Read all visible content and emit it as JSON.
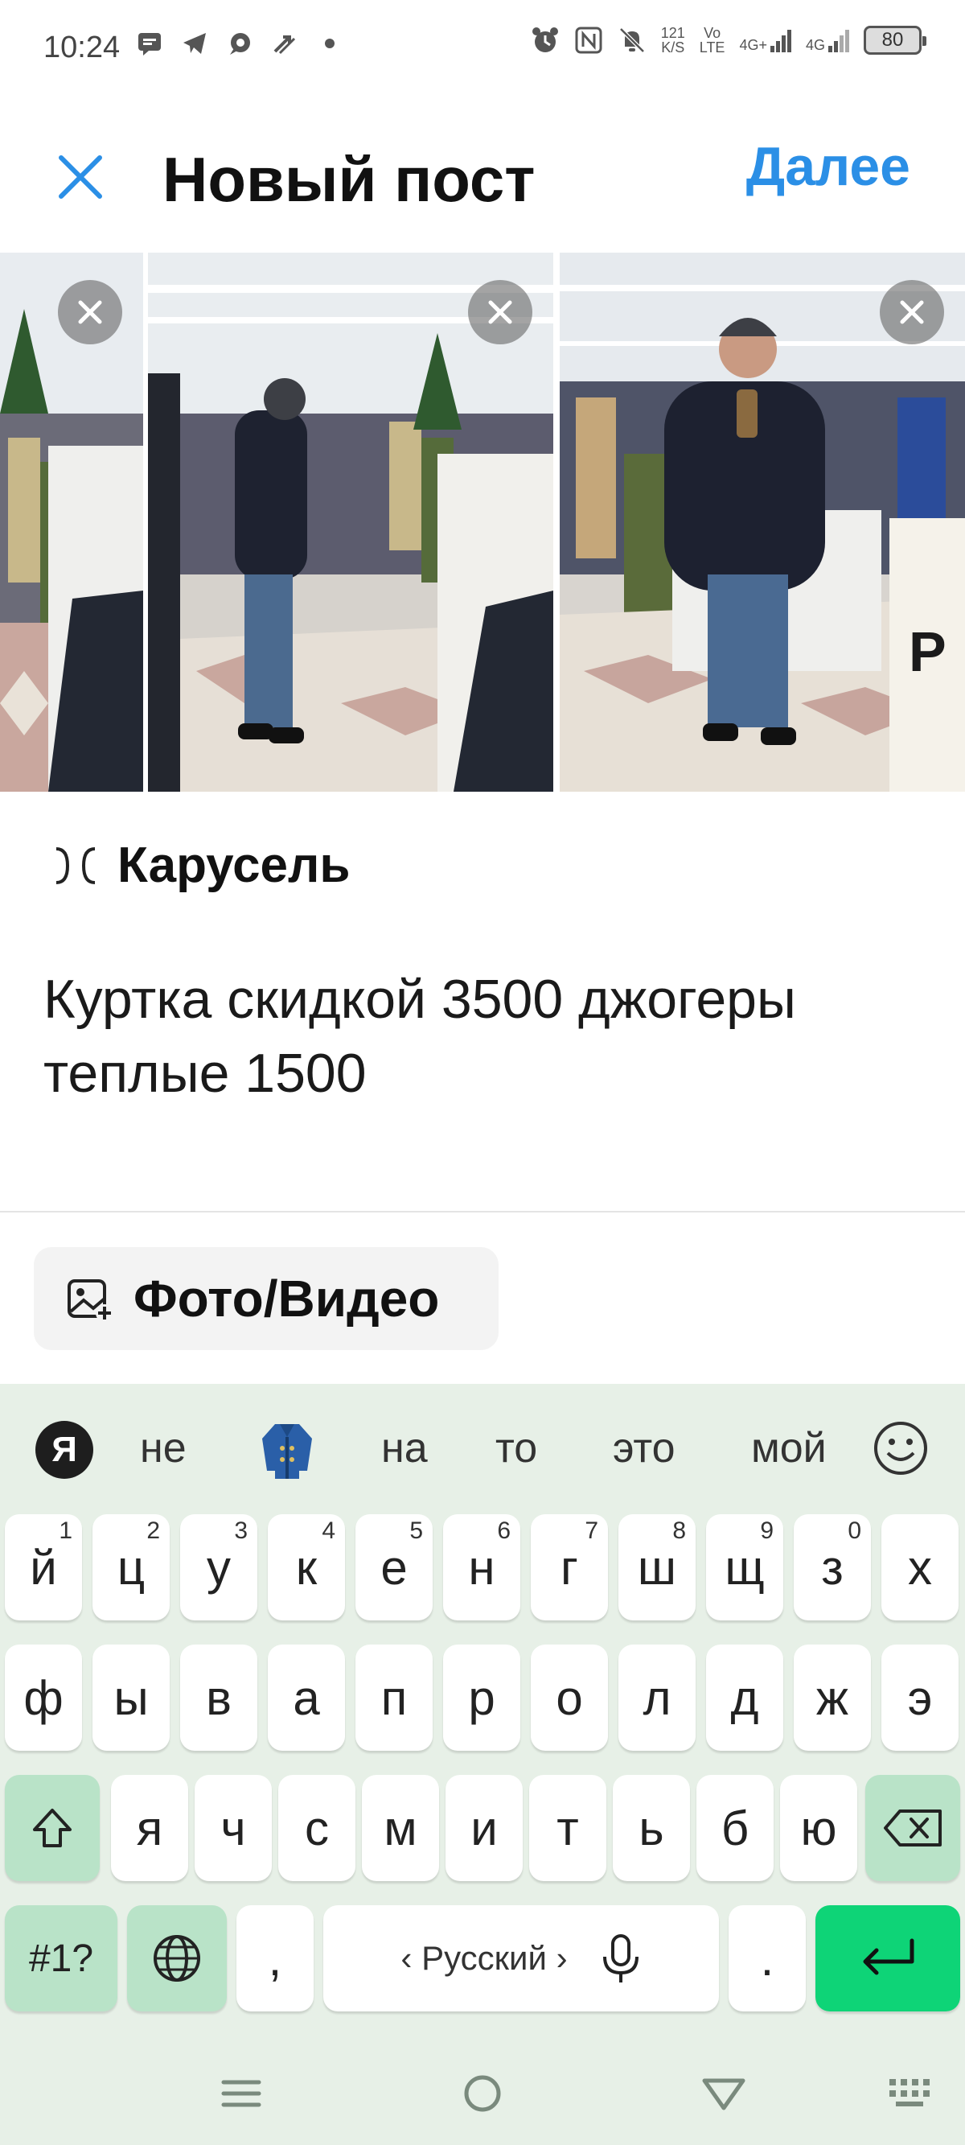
{
  "status": {
    "time": "10:24",
    "speed_top": "121",
    "speed_bottom": "K/S",
    "volte_top": "Vo",
    "volte_bottom": "LTE",
    "net1": "4G+",
    "net2": "4G",
    "battery": "80"
  },
  "header": {
    "title": "Новый пост",
    "next_label": "Далее"
  },
  "carousel": {
    "label": "Карусель"
  },
  "post": {
    "caption": "Куртка скидкой 3500 джогеры теплые 1500"
  },
  "media": {
    "button_label": "Фото/Видео"
  },
  "keyboard": {
    "logo": "Я",
    "suggestions": [
      "не",
      "на",
      "то",
      "это",
      "мой"
    ],
    "row1": [
      {
        "k": "й",
        "h": "1"
      },
      {
        "k": "ц",
        "h": "2"
      },
      {
        "k": "у",
        "h": "3"
      },
      {
        "k": "к",
        "h": "4"
      },
      {
        "k": "е",
        "h": "5"
      },
      {
        "k": "н",
        "h": "6"
      },
      {
        "k": "г",
        "h": "7"
      },
      {
        "k": "ш",
        "h": "8"
      },
      {
        "k": "щ",
        "h": "9"
      },
      {
        "k": "з",
        "h": "0"
      },
      {
        "k": "х",
        "h": ""
      }
    ],
    "row2": [
      "ф",
      "ы",
      "в",
      "а",
      "п",
      "р",
      "о",
      "л",
      "д",
      "ж",
      "э"
    ],
    "row3": [
      "я",
      "ч",
      "с",
      "м",
      "и",
      "т",
      "ь",
      "б",
      "ю"
    ],
    "symbols_label": "#1?",
    "comma": ",",
    "space_label": "‹ Русский ›",
    "period": "."
  },
  "colors": {
    "accent": "#2b8fe6",
    "keyboard_bg": "#e7f0e7",
    "mod_key": "#b9e3c8",
    "enter_key": "#0ed477"
  }
}
